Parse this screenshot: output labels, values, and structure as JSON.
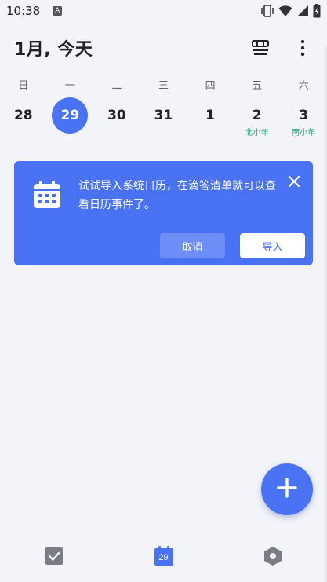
{
  "status_bar": {
    "time": "10:38",
    "app_badge": "A",
    "icons": [
      "vibrate-icon",
      "wifi-icon",
      "signal-icon",
      "battery-icon"
    ]
  },
  "header": {
    "title": "1月, 今天",
    "actions": [
      "view-toggle-icon",
      "more-icon"
    ]
  },
  "week": {
    "weekdays": [
      "日",
      "一",
      "二",
      "三",
      "四",
      "五",
      "六"
    ],
    "days": [
      {
        "num": "28",
        "sub": ""
      },
      {
        "num": "29",
        "sub": ""
      },
      {
        "num": "30",
        "sub": ""
      },
      {
        "num": "31",
        "sub": ""
      },
      {
        "num": "1",
        "sub": ""
      },
      {
        "num": "2",
        "sub": "北小年"
      },
      {
        "num": "3",
        "sub": "南小年"
      }
    ],
    "selected_index": 1
  },
  "banner": {
    "message": "试试导入系统日历，在滴答清单就可以查看日历事件了。",
    "cancel_label": "取消",
    "import_label": "导入"
  },
  "bottom_nav": {
    "calendar_day": "29",
    "items": [
      "task-check-icon",
      "calendar-icon",
      "settings-icon"
    ]
  },
  "colors": {
    "accent": "#4a72f5",
    "background": "#f3f4fa",
    "lunar_green": "#1aa66b"
  }
}
